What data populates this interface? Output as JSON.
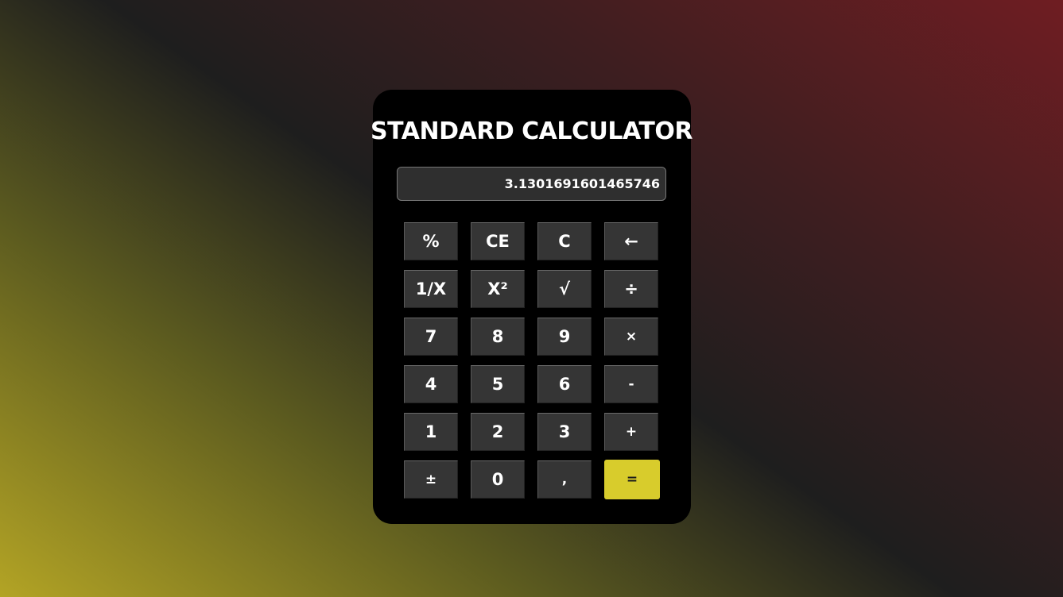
{
  "title": "STANDARD CALCULATOR",
  "display": {
    "value": "3.1301691601465746"
  },
  "keys": [
    [
      "%",
      "CE",
      "C",
      "←"
    ],
    [
      "1/X",
      "X²",
      "√",
      "÷"
    ],
    [
      "7",
      "8",
      "9",
      "×"
    ],
    [
      "4",
      "5",
      "6",
      "-"
    ],
    [
      "1",
      "2",
      "3",
      "+"
    ],
    [
      "±",
      "0",
      ",",
      "="
    ]
  ],
  "colors": {
    "calculator_bg": "#000000",
    "key_bg": "#353535",
    "equals_bg": "#d8cc2c",
    "gradient_yellow": "#b3a425",
    "gradient_red": "#6f1d22"
  }
}
